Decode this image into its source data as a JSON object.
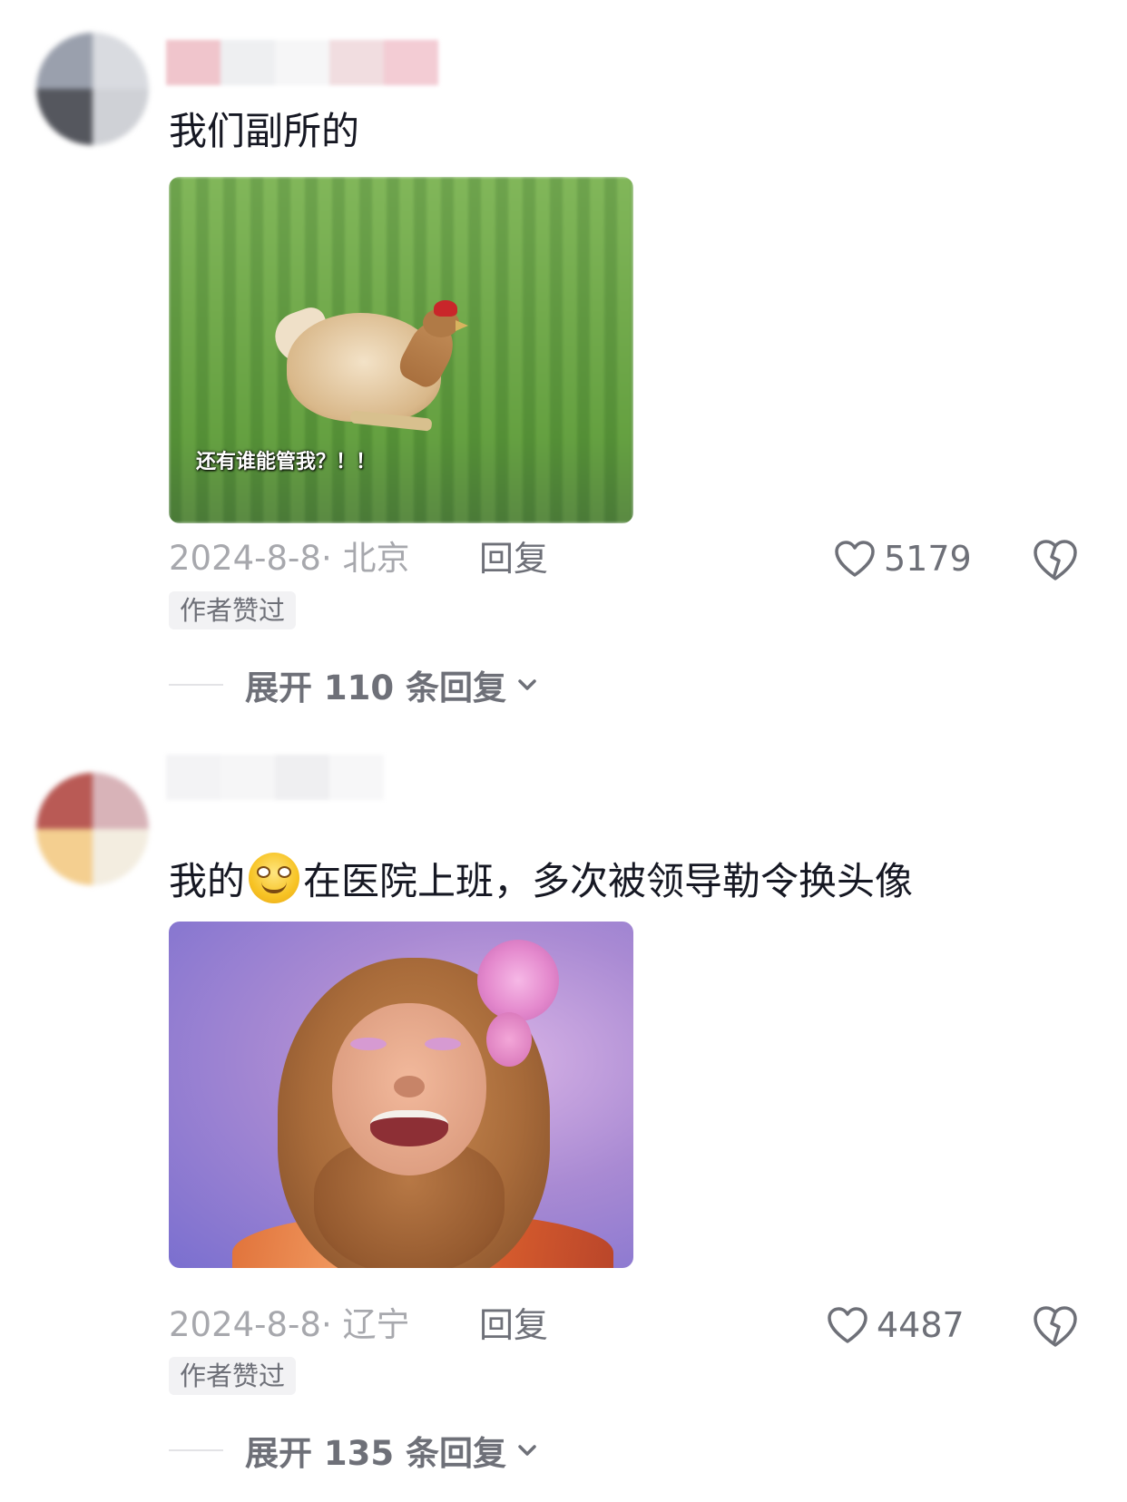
{
  "comments": [
    {
      "text": "我们副所的",
      "media": {
        "subtitle": "还有谁能管我？！！"
      },
      "date": "2024-8-8",
      "location": "北京",
      "date_location": "2024-8-8· 北京",
      "reply_label": "回复",
      "likes": "5179",
      "badge": "作者赞过",
      "expand_label": "展开 110 条回复",
      "icons": {
        "like": "heart-outline-icon",
        "dislike": "broken-heart-icon",
        "expand": "chevron-down-icon"
      }
    },
    {
      "text_before_emoji": "我的",
      "emoji": "smiling-face-emoji",
      "text_after_emoji": "在医院上班，多次被领导勒令换头像",
      "media": {},
      "date": "2024-8-8",
      "location": "辽宁",
      "date_location": "2024-8-8· 辽宁",
      "reply_label": "回复",
      "likes": "4487",
      "badge": "作者赞过",
      "expand_label": "展开 135 条回复",
      "icons": {
        "like": "heart-outline-icon",
        "dislike": "broken-heart-icon",
        "expand": "chevron-down-icon"
      }
    }
  ],
  "colors": {
    "primary_text": "#161823",
    "secondary_text": "#6e7078",
    "muted_text": "#a7a8ad",
    "badge_bg": "#f2f2f4"
  }
}
